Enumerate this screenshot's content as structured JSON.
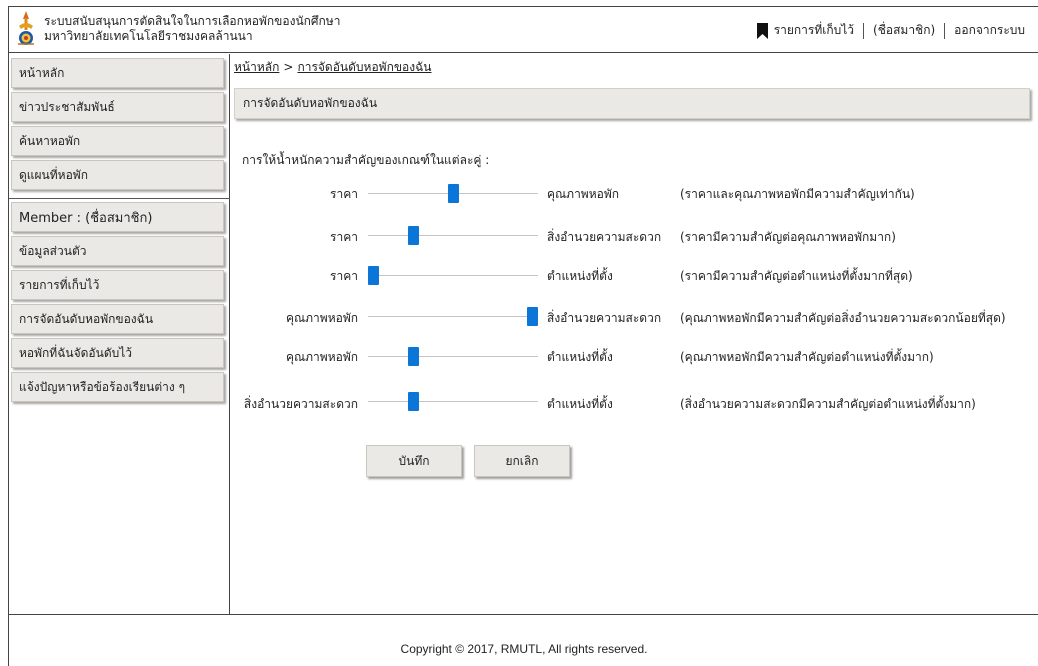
{
  "header": {
    "title_line1": "ระบบสนับสนุนการตัดสินใจในการเลือกหอพักของนักศึกษา",
    "title_line2": "มหาวิทยาลัยเทคโนโลยีราชมงคลล้านนา",
    "saved_link": "รายการที่เก็บไว้",
    "member_link": "(ชื่อสมาชิก)",
    "logout_link": "ออกจากระบบ"
  },
  "sidebar": {
    "main_items": [
      {
        "label": "หน้าหลัก"
      },
      {
        "label": "ข่าวประชาสัมพันธ์"
      },
      {
        "label": "ค้นหาหอพัก"
      },
      {
        "label": "ดูแผนที่หอพัก"
      }
    ],
    "member_items": [
      {
        "label": "Member : (ชื่อสมาชิก)"
      },
      {
        "label": "ข้อมูลส่วนตัว"
      },
      {
        "label": "รายการที่เก็บไว้"
      },
      {
        "label": "การจัดอันดับหอพักของฉัน"
      },
      {
        "label": "หอพักที่ฉันจัดอันดับไว้"
      },
      {
        "label": "แจ้งปัญหาหรือข้อร้องเรียนต่าง ๆ"
      }
    ]
  },
  "breadcrumb": {
    "home": "หน้าหลัก",
    "separator": ">",
    "current": "การจัดอันดับหอพักของฉัน"
  },
  "page_title": "การจัดอันดับหอพักของฉัน",
  "instruction": "การให้น้ำหนักความสำคัญของเกณฑ์ในแต่ละคู่ :",
  "comparisons": [
    {
      "left": "ราคา",
      "right": "คุณภาพหอพัก",
      "note": "(ราคาและคุณภาพหอพักมีความสำคัญเท่ากัน)",
      "slider_value": 0.5
    },
    {
      "left": "ราคา",
      "right": "สิ่งอำนวยความสะดวก",
      "note": "(ราคามีความสำคัญต่อคุณภาพหอพักมาก)",
      "slider_value": 0.25
    },
    {
      "left": "ราคา",
      "right": "ตำแหน่งที่ตั้ง",
      "note": "(ราคามีความสำคัญต่อตำแหน่งที่ตั้งมากที่สุด)",
      "slider_value": 0.0
    },
    {
      "left": "คุณภาพหอพัก",
      "right": "สิ่งอำนวยความสะดวก",
      "note": "(คุณภาพหอพักมีความสำคัญต่อสิ่งอำนวยความสะดวกน้อยที่สุด)",
      "slider_value": 1.0
    },
    {
      "left": "คุณภาพหอพัก",
      "right": "ตำแหน่งที่ตั้ง",
      "note": "(คุณภาพหอพักมีความสำคัญต่อตำแหน่งที่ตั้งมาก)",
      "slider_value": 0.25
    },
    {
      "left": "สิ่งอำนวยความสะดวก",
      "right": "ตำแหน่งที่ตั้ง",
      "note": "(สิ่งอำนวยความสะดวกมีความสำคัญต่อตำแหน่งที่ตั้งมาก)",
      "slider_value": 0.25
    }
  ],
  "buttons": {
    "save": "บันทึก",
    "cancel": "ยกเลิก"
  },
  "footer": {
    "copyright": "Copyright © 2017, RMUTL, All rights reserved."
  },
  "colors": {
    "slider_thumb": "#0b76d8",
    "panel_bg": "#ebe9e5"
  },
  "icons": {
    "logo": "university-logo",
    "saved": "bookmark-icon"
  }
}
